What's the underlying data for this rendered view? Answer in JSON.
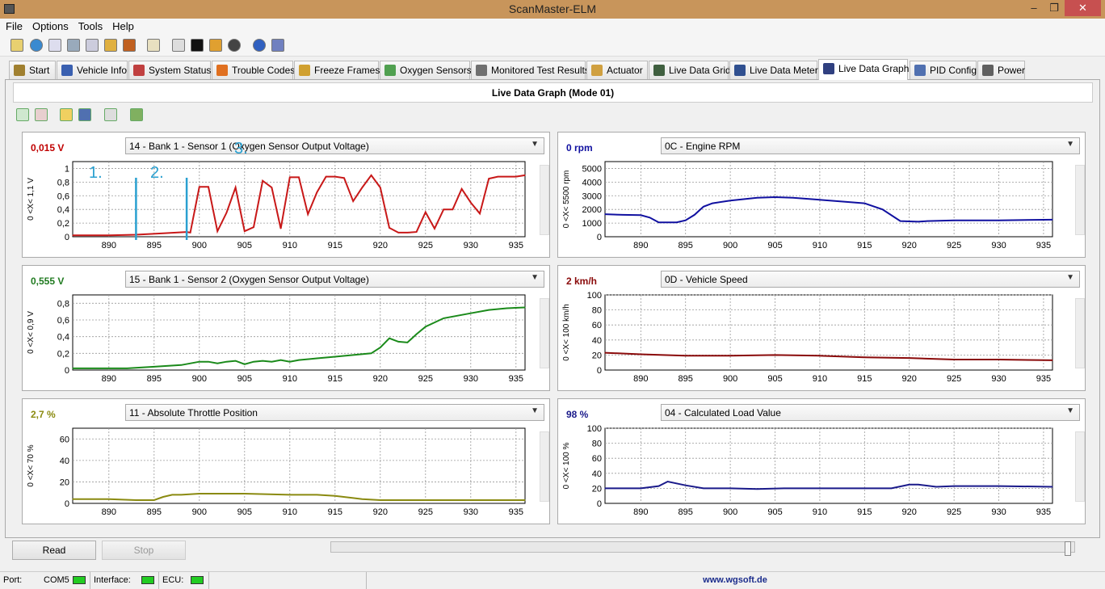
{
  "window": {
    "title": "ScanMaster-ELM",
    "minimize": "–",
    "maximize": "❐",
    "close": "✕"
  },
  "menu": [
    "File",
    "Options",
    "Tools",
    "Help"
  ],
  "tabs": [
    {
      "label": "Start",
      "icon": "start-icon"
    },
    {
      "label": "Vehicle Info",
      "icon": "info-icon"
    },
    {
      "label": "System Status",
      "icon": "status-icon"
    },
    {
      "label": "Trouble Codes",
      "icon": "warning-icon"
    },
    {
      "label": "Freeze Frames",
      "icon": "freeze-icon"
    },
    {
      "label": "Oxygen Sensors",
      "icon": "sensor-icon"
    },
    {
      "label": "Monitored Test Results",
      "icon": "gear-icon"
    },
    {
      "label": "Actuator",
      "icon": "actuator-icon"
    },
    {
      "label": "Live Data Grid",
      "icon": "grid-icon"
    },
    {
      "label": "Live Data Meter",
      "icon": "meter-icon"
    },
    {
      "label": "Live Data Graph",
      "icon": "graph-icon"
    },
    {
      "label": "PID Config",
      "icon": "config-icon"
    },
    {
      "label": "Power",
      "icon": "power-icon"
    }
  ],
  "active_tab": "Live Data Graph",
  "panel_title": "Live Data Graph (Mode 01)",
  "graphs": [
    {
      "value": "0,015 V",
      "value_color": "#c00000",
      "pid": "14 - Bank 1 - Sensor 1 (Oxygen Sensor Output Voltage)",
      "range_label": "0  <X<  1,1  V"
    },
    {
      "value": "0 rpm",
      "value_color": "#1010a0",
      "pid": "0C - Engine RPM",
      "range_label": "0  <X<  5500  rpm"
    },
    {
      "value": "0,555 V",
      "value_color": "#207a20",
      "pid": "15 - Bank 1 - Sensor 2 (Oxygen Sensor Output Voltage)",
      "range_label": "0  <X<  0,9  V"
    },
    {
      "value": "2 km/h",
      "value_color": "#8a0a0a",
      "pid": "0D - Vehicle Speed",
      "range_label": "0  <X<  100  km/h"
    },
    {
      "value": "2,7 %",
      "value_color": "#8a8a10",
      "pid": "11 - Absolute Throttle Position",
      "range_label": "0  <X<  70  %"
    },
    {
      "value": "98 %",
      "value_color": "#1a1a8a",
      "pid": "04 - Calculated Load Value",
      "range_label": "0  <X<  100  %"
    }
  ],
  "annotations": [
    "1.",
    "2.",
    "3."
  ],
  "buttons": {
    "read": "Read",
    "stop": "Stop"
  },
  "status": {
    "port_label": "Port:",
    "port_value": "COM5",
    "interface_label": "Interface:",
    "ecu_label": "ECU:",
    "url": "www.wgsoft.de"
  },
  "chart_data": [
    {
      "type": "line",
      "x_ticks": [
        890,
        895,
        900,
        905,
        910,
        915,
        920,
        925,
        930,
        935
      ],
      "y_ticks": [
        "0",
        "0,2",
        "0,4",
        "0,6",
        "0,8",
        "1"
      ],
      "ylim": [
        0,
        1.1
      ],
      "xlim": [
        886,
        936
      ],
      "color": "#c81818",
      "x": [
        886,
        890,
        893,
        896,
        898.6,
        899,
        900,
        901,
        902,
        903,
        904,
        905,
        906,
        907,
        908,
        909,
        910,
        911,
        912,
        913,
        914,
        915,
        916,
        917,
        918,
        919,
        920,
        921,
        922,
        923,
        924,
        925,
        926,
        927,
        928,
        929,
        930,
        931,
        932,
        933,
        934,
        935,
        936
      ],
      "values": [
        0.02,
        0.02,
        0.03,
        0.05,
        0.07,
        0.06,
        0.73,
        0.73,
        0.08,
        0.35,
        0.72,
        0.08,
        0.14,
        0.82,
        0.72,
        0.12,
        0.87,
        0.87,
        0.33,
        0.65,
        0.88,
        0.88,
        0.86,
        0.52,
        0.72,
        0.9,
        0.72,
        0.13,
        0.06,
        0.06,
        0.07,
        0.36,
        0.12,
        0.4,
        0.4,
        0.7,
        0.5,
        0.34,
        0.85,
        0.88,
        0.88,
        0.88,
        0.9
      ]
    },
    {
      "type": "line",
      "x_ticks": [
        890,
        895,
        900,
        905,
        910,
        915,
        920,
        925,
        930,
        935
      ],
      "y_ticks": [
        "0",
        "1000",
        "2000",
        "3000",
        "4000",
        "5000"
      ],
      "ylim": [
        0,
        5500
      ],
      "xlim": [
        886,
        936
      ],
      "color": "#1010a0",
      "x": [
        886,
        888,
        890,
        891,
        892,
        894,
        895,
        896,
        897,
        898,
        900,
        903,
        905,
        907,
        910,
        913,
        915,
        917,
        919,
        921,
        922,
        925,
        930,
        936
      ],
      "values": [
        1650,
        1600,
        1580,
        1400,
        1050,
        1050,
        1200,
        1600,
        2200,
        2450,
        2650,
        2850,
        2900,
        2850,
        2700,
        2550,
        2450,
        2000,
        1150,
        1100,
        1150,
        1200,
        1200,
        1250
      ]
    },
    {
      "type": "line",
      "x_ticks": [
        890,
        895,
        900,
        905,
        910,
        915,
        920,
        925,
        930,
        935
      ],
      "y_ticks": [
        "0",
        "0,2",
        "0,4",
        "0,6",
        "0,8"
      ],
      "ylim": [
        0,
        0.9
      ],
      "xlim": [
        886,
        936
      ],
      "color": "#1a8a1a",
      "x": [
        886,
        889,
        892,
        895,
        898,
        900,
        901,
        902,
        903,
        904,
        905,
        906,
        907,
        908,
        909,
        910,
        911,
        913,
        915,
        917,
        919,
        920,
        921,
        922,
        923,
        924,
        925,
        927,
        930,
        932,
        934,
        936
      ],
      "values": [
        0.02,
        0.02,
        0.02,
        0.04,
        0.06,
        0.1,
        0.1,
        0.08,
        0.1,
        0.11,
        0.07,
        0.1,
        0.11,
        0.1,
        0.12,
        0.1,
        0.12,
        0.14,
        0.16,
        0.18,
        0.2,
        0.27,
        0.38,
        0.34,
        0.33,
        0.43,
        0.52,
        0.62,
        0.68,
        0.72,
        0.74,
        0.75
      ]
    },
    {
      "type": "line",
      "x_ticks": [
        890,
        895,
        900,
        905,
        910,
        915,
        920,
        925,
        930,
        935
      ],
      "y_ticks": [
        "0",
        "20",
        "40",
        "60",
        "80",
        "100"
      ],
      "ylim": [
        0,
        100
      ],
      "xlim": [
        886,
        936
      ],
      "color": "#8a0a0a",
      "x": [
        886,
        890,
        895,
        900,
        905,
        910,
        915,
        920,
        925,
        930,
        936
      ],
      "values": [
        23,
        21,
        19,
        19,
        20,
        19,
        17,
        16,
        14,
        14,
        13
      ]
    },
    {
      "type": "line",
      "x_ticks": [
        890,
        895,
        900,
        905,
        910,
        915,
        920,
        925,
        930,
        935
      ],
      "y_ticks": [
        "0",
        "20",
        "40",
        "60"
      ],
      "ylim": [
        0,
        70
      ],
      "xlim": [
        886,
        936
      ],
      "color": "#8a8a10",
      "x": [
        886,
        890,
        893,
        895,
        896,
        897,
        898,
        900,
        905,
        910,
        913,
        915,
        917,
        918,
        920,
        925,
        930,
        936
      ],
      "values": [
        4,
        4,
        3,
        3,
        6,
        8,
        8,
        9,
        9,
        8,
        8,
        7,
        5,
        4,
        3,
        3,
        3,
        3
      ]
    },
    {
      "type": "line",
      "x_ticks": [
        890,
        895,
        900,
        905,
        910,
        915,
        920,
        925,
        930,
        935
      ],
      "y_ticks": [
        "0",
        "20",
        "40",
        "60",
        "80",
        "100"
      ],
      "ylim": [
        0,
        100
      ],
      "xlim": [
        886,
        936
      ],
      "color": "#1a1a8a",
      "x": [
        886,
        890,
        892,
        893,
        895,
        897,
        900,
        903,
        906,
        910,
        915,
        918,
        920,
        921,
        923,
        925,
        930,
        936
      ],
      "values": [
        20,
        20,
        23,
        29,
        24,
        20,
        20,
        19,
        20,
        20,
        20,
        20,
        25,
        25,
        22,
        23,
        23,
        22
      ]
    }
  ]
}
